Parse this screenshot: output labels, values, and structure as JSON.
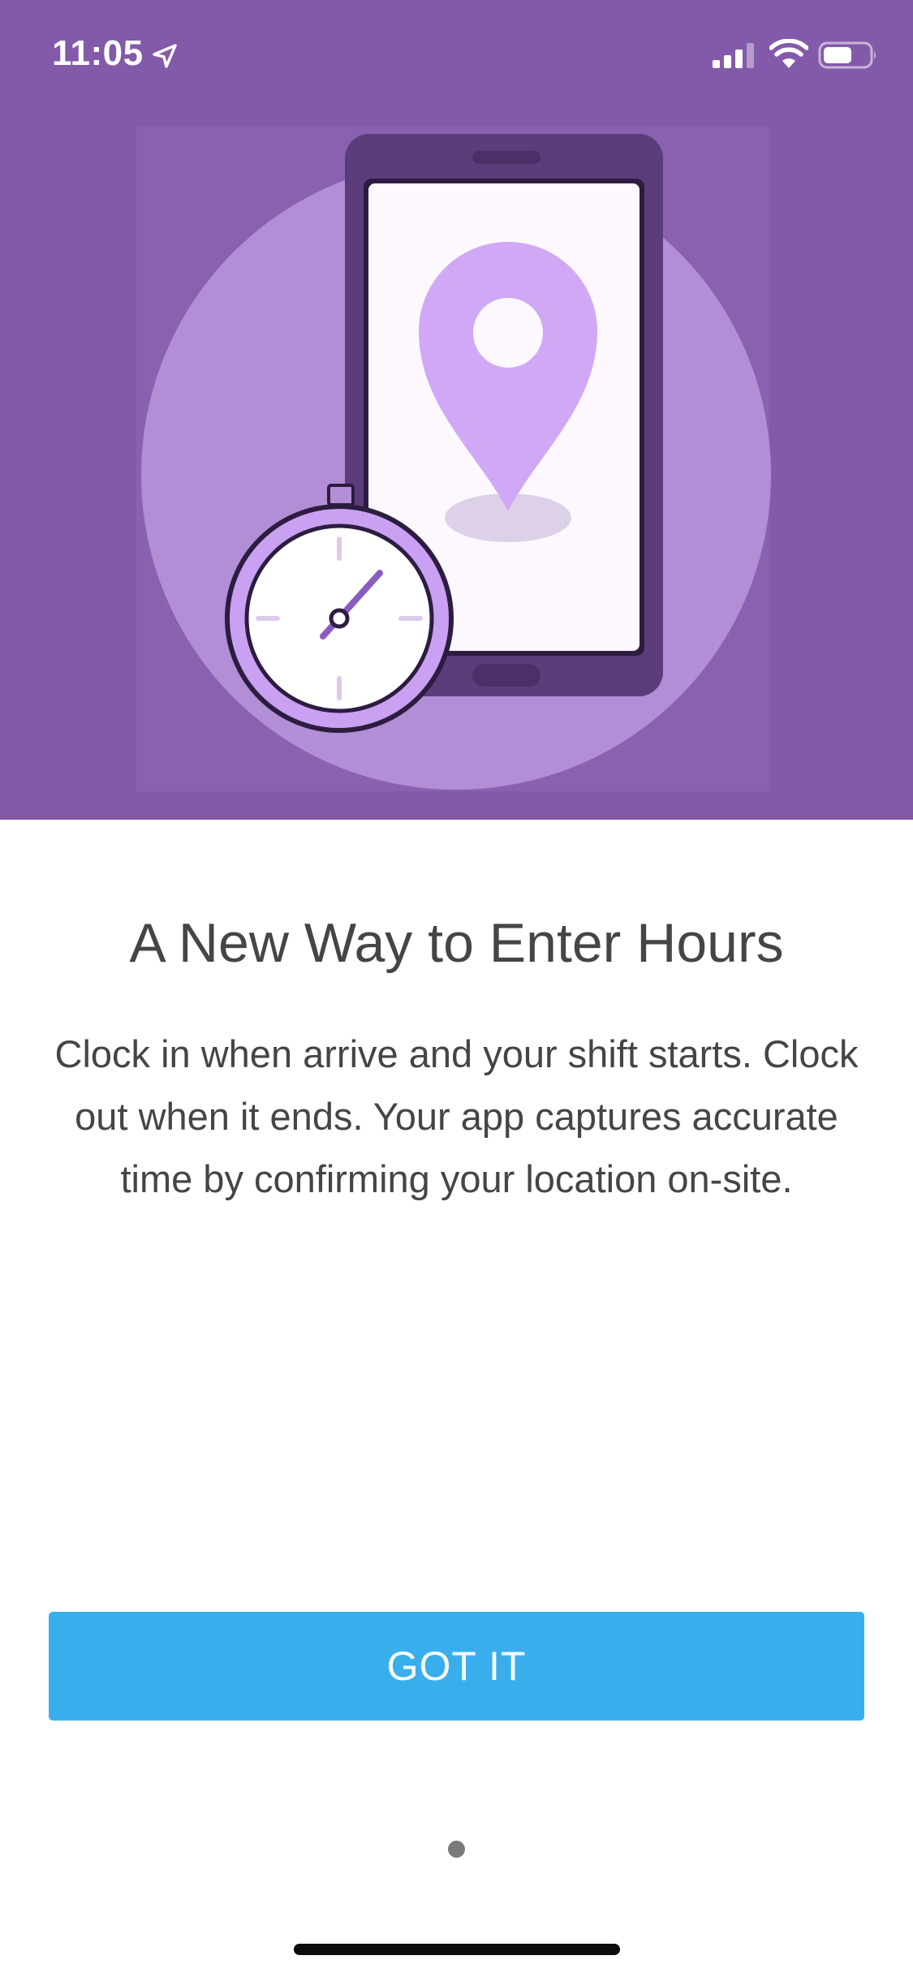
{
  "status_bar": {
    "time": "11:05"
  },
  "icons": {
    "location": "location-arrow-icon",
    "signal": "cellular-signal-icon",
    "wifi": "wifi-icon",
    "battery": "battery-icon",
    "illustration": "phone-location-stopwatch-illustration"
  },
  "colors": {
    "hero_background": "#835aa9",
    "accent_button": "#38afec",
    "text": "#454545"
  },
  "onboarding": {
    "title": "A New Way to Enter Hours",
    "body": "Clock in when arrive and your shift starts. Clock out when it ends. Your app captures accurate time by confirming your location on-site.",
    "button_label": "GOT IT",
    "page_count": 1,
    "current_page": 1
  }
}
